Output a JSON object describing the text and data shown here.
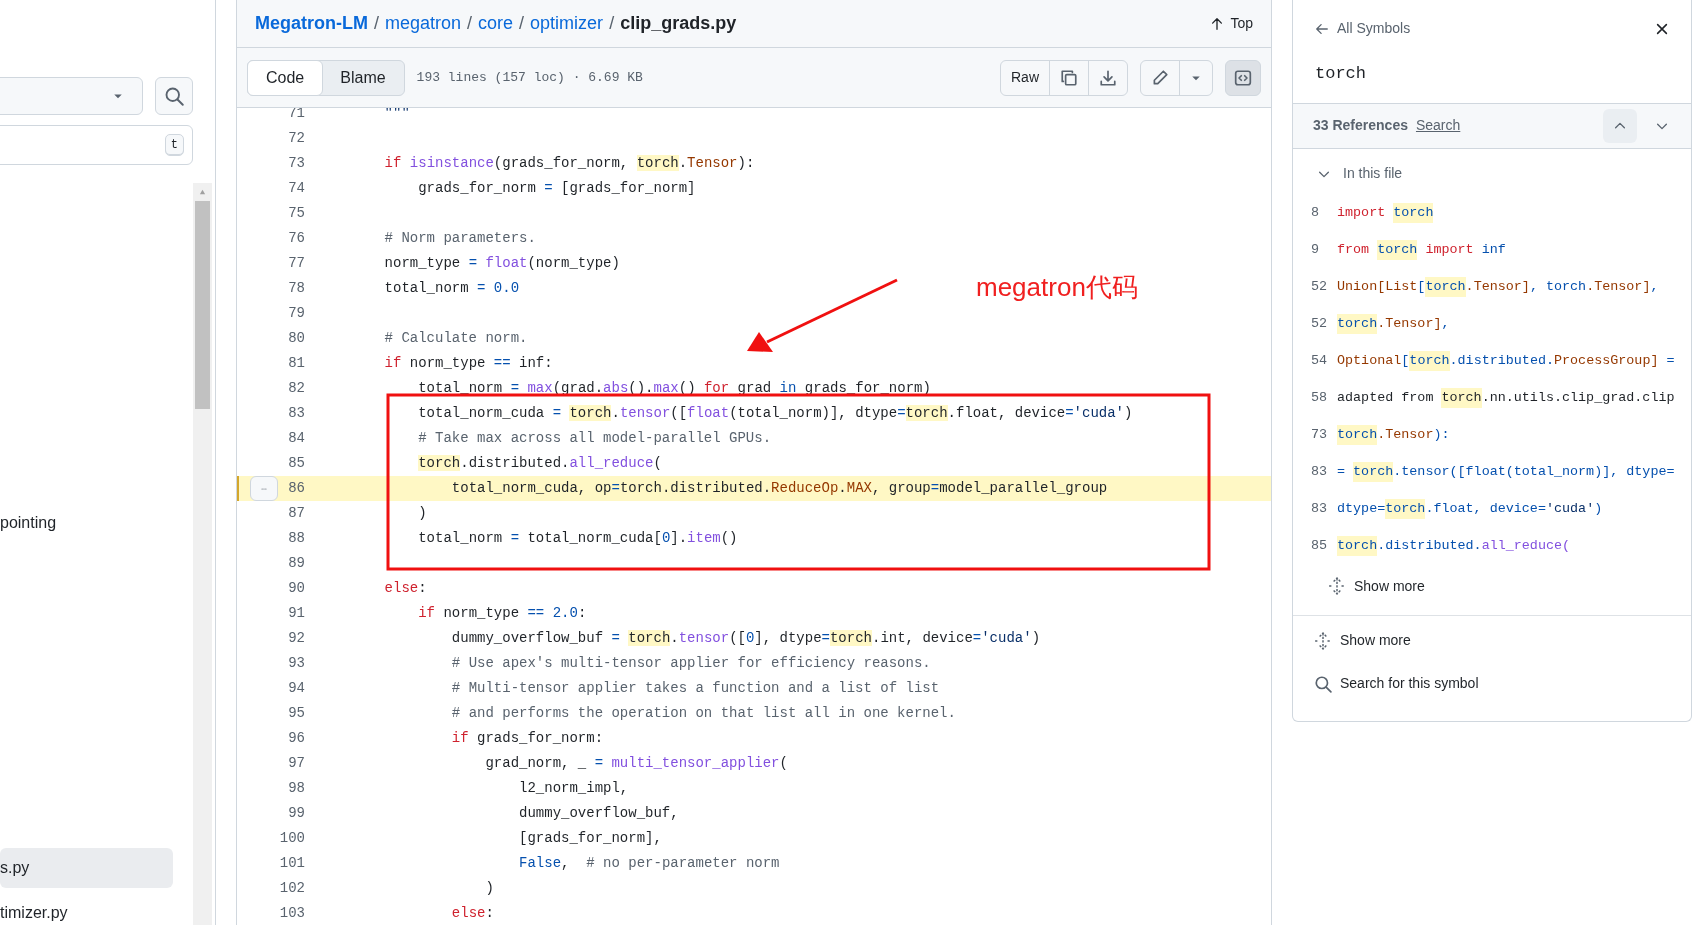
{
  "sidebar": {
    "filter_key": "t",
    "items": [
      {
        "label": "pointing",
        "selected": false
      },
      {
        "label": "s.py",
        "selected": true
      },
      {
        "label": "timizer.py",
        "selected": false
      }
    ]
  },
  "breadcrumb": [
    {
      "label": "Megatron-LM",
      "kind": "repo"
    },
    {
      "label": "/",
      "kind": "separator"
    },
    {
      "label": "megatron",
      "kind": "link"
    },
    {
      "label": "/",
      "kind": "separator"
    },
    {
      "label": "core",
      "kind": "link"
    },
    {
      "label": "/",
      "kind": "separator"
    },
    {
      "label": "optimizer",
      "kind": "link"
    },
    {
      "label": "/",
      "kind": "separator"
    },
    {
      "label": "clip_grads.py",
      "kind": "current"
    }
  ],
  "top_link": "Top",
  "toolbar": {
    "tabs": [
      {
        "label": "Code",
        "selected": true
      },
      {
        "label": "Blame",
        "selected": false
      }
    ],
    "file_info": "193 lines (157 loc) · 6.69 KB",
    "raw_button": "Raw",
    "symbols_button_active": true
  },
  "code": {
    "lines": [
      {
        "number": "71",
        "selected": false,
        "tokens": [
          {
            "kind": "str",
            "text": "    \"\"\""
          }
        ]
      },
      {
        "number": "72",
        "selected": false
      },
      {
        "number": "73",
        "selected": false,
        "tokens": [
          {
            "kind": "kw",
            "text": "    if"
          },
          {
            "kind": "fn",
            "text": " isinstance"
          },
          {
            "kind": "plain",
            "text": "(grads_for_norm, "
          },
          {
            "kind": "match",
            "text": "torch"
          },
          {
            "kind": "plain",
            "text": "."
          },
          {
            "kind": "cls",
            "text": "Tensor"
          },
          {
            "kind": "plain",
            "text": "):"
          }
        ]
      },
      {
        "number": "74",
        "selected": false,
        "tokens": [
          {
            "kind": "plain",
            "text": "        grads_for_norm "
          },
          {
            "kind": "num",
            "text": "="
          },
          {
            "kind": "plain",
            "text": " [grads_for_norm]"
          }
        ]
      },
      {
        "number": "75",
        "selected": false
      },
      {
        "number": "76",
        "selected": false,
        "tokens": [
          {
            "kind": "com",
            "text": "    # Norm parameters."
          }
        ]
      },
      {
        "number": "77",
        "selected": false,
        "tokens": [
          {
            "kind": "plain",
            "text": "    norm_type "
          },
          {
            "kind": "num",
            "text": "="
          },
          {
            "kind": "fn",
            "text": " float"
          },
          {
            "kind": "plain",
            "text": "(norm_type)"
          }
        ]
      },
      {
        "number": "78",
        "selected": false,
        "tokens": [
          {
            "kind": "plain",
            "text": "    total_norm "
          },
          {
            "kind": "num",
            "text": "= 0.0"
          }
        ]
      },
      {
        "number": "79",
        "selected": false
      },
      {
        "number": "80",
        "selected": false,
        "tokens": [
          {
            "kind": "com",
            "text": "    # Calculate norm."
          }
        ]
      },
      {
        "number": "81",
        "selected": false,
        "tokens": [
          {
            "kind": "kw",
            "text": "    if"
          },
          {
            "kind": "plain",
            "text": " norm_type "
          },
          {
            "kind": "num",
            "text": "=="
          },
          {
            "kind": "plain",
            "text": " inf:"
          }
        ]
      },
      {
        "number": "82",
        "selected": false,
        "tokens": [
          {
            "kind": "plain",
            "text": "        total_norm "
          },
          {
            "kind": "num",
            "text": "="
          },
          {
            "kind": "fn",
            "text": " max"
          },
          {
            "kind": "plain",
            "text": "(grad."
          },
          {
            "kind": "fn",
            "text": "abs"
          },
          {
            "kind": "plain",
            "text": "()."
          },
          {
            "kind": "fn",
            "text": "max"
          },
          {
            "kind": "plain",
            "text": "() "
          },
          {
            "kind": "kw",
            "text": "for"
          },
          {
            "kind": "plain",
            "text": " grad "
          },
          {
            "kind": "num",
            "text": "in"
          },
          {
            "kind": "plain",
            "text": " grads_for_norm)"
          }
        ]
      },
      {
        "number": "83",
        "selected": false,
        "tokens": [
          {
            "kind": "plain",
            "text": "        total_norm_cuda "
          },
          {
            "kind": "num",
            "text": "= "
          },
          {
            "kind": "match",
            "text": "torch"
          },
          {
            "kind": "plain",
            "text": "."
          },
          {
            "kind": "fn",
            "text": "tensor"
          },
          {
            "kind": "plain",
            "text": "(["
          },
          {
            "kind": "fn",
            "text": "float"
          },
          {
            "kind": "plain",
            "text": "(total_norm)], dtype"
          },
          {
            "kind": "num",
            "text": "="
          },
          {
            "kind": "match",
            "text": "torch"
          },
          {
            "kind": "plain",
            "text": ".float, device"
          },
          {
            "kind": "num",
            "text": "="
          },
          {
            "kind": "str",
            "text": "'cuda'"
          },
          {
            "kind": "plain",
            "text": ")"
          }
        ]
      },
      {
        "number": "84",
        "selected": false,
        "tokens": [
          {
            "kind": "com",
            "text": "        # Take max across all model-parallel GPUs."
          }
        ]
      },
      {
        "number": "85",
        "selected": false,
        "tokens": [
          {
            "kind": "match",
            "text": "        torch"
          },
          {
            "kind": "plain",
            "text": ".distributed."
          },
          {
            "kind": "fn",
            "text": "all_reduce"
          },
          {
            "kind": "plain",
            "text": "("
          }
        ]
      },
      {
        "number": "86",
        "selected": true,
        "tokens": [
          {
            "kind": "plain",
            "text": "            total_norm_cuda, op"
          },
          {
            "kind": "num",
            "text": "="
          },
          {
            "kind": "match",
            "text": "torch"
          },
          {
            "kind": "plain",
            "text": ".distributed."
          },
          {
            "kind": "cls",
            "text": "ReduceOp"
          },
          {
            "kind": "plain",
            "text": "."
          },
          {
            "kind": "cls",
            "text": "MAX"
          },
          {
            "kind": "plain",
            "text": ", group"
          },
          {
            "kind": "num",
            "text": "="
          },
          {
            "kind": "plain",
            "text": "model_parallel_group"
          }
        ]
      },
      {
        "number": "87",
        "selected": false,
        "tokens": [
          {
            "kind": "plain",
            "text": "        )"
          }
        ]
      },
      {
        "number": "88",
        "selected": false,
        "tokens": [
          {
            "kind": "plain",
            "text": "        total_norm "
          },
          {
            "kind": "num",
            "text": "="
          },
          {
            "kind": "plain",
            "text": " total_norm_cuda["
          },
          {
            "kind": "num",
            "text": "0"
          },
          {
            "kind": "plain",
            "text": "]."
          },
          {
            "kind": "fn",
            "text": "item"
          },
          {
            "kind": "plain",
            "text": "()"
          }
        ]
      },
      {
        "number": "89",
        "selected": false
      },
      {
        "number": "90",
        "selected": false,
        "tokens": [
          {
            "kind": "kw",
            "text": "    else"
          },
          {
            "kind": "plain",
            "text": ":"
          }
        ]
      },
      {
        "number": "91",
        "selected": false,
        "tokens": [
          {
            "kind": "kw",
            "text": "        if"
          },
          {
            "kind": "plain",
            "text": " norm_type "
          },
          {
            "kind": "num",
            "text": "== 2.0"
          },
          {
            "kind": "plain",
            "text": ":"
          }
        ]
      },
      {
        "number": "92",
        "selected": false,
        "tokens": [
          {
            "kind": "plain",
            "text": "            dummy_overflow_buf "
          },
          {
            "kind": "num",
            "text": "= "
          },
          {
            "kind": "match",
            "text": "torch"
          },
          {
            "kind": "plain",
            "text": "."
          },
          {
            "kind": "fn",
            "text": "tensor"
          },
          {
            "kind": "plain",
            "text": "(["
          },
          {
            "kind": "num",
            "text": "0"
          },
          {
            "kind": "plain",
            "text": "], dtype"
          },
          {
            "kind": "num",
            "text": "="
          },
          {
            "kind": "match",
            "text": "torch"
          },
          {
            "kind": "plain",
            "text": ".int, device"
          },
          {
            "kind": "num",
            "text": "="
          },
          {
            "kind": "str",
            "text": "'cuda'"
          },
          {
            "kind": "plain",
            "text": ")"
          }
        ]
      },
      {
        "number": "93",
        "selected": false,
        "tokens": [
          {
            "kind": "com",
            "text": "            # Use apex's multi-tensor applier for efficiency reasons."
          }
        ]
      },
      {
        "number": "94",
        "selected": false,
        "tokens": [
          {
            "kind": "com",
            "text": "            # Multi-tensor applier takes a function and a list of list"
          }
        ]
      },
      {
        "number": "95",
        "selected": false,
        "tokens": [
          {
            "kind": "com",
            "text": "            # and performs the operation on that list all in one kernel."
          }
        ]
      },
      {
        "number": "96",
        "selected": false,
        "tokens": [
          {
            "kind": "kw",
            "text": "            if"
          },
          {
            "kind": "plain",
            "text": " grads_for_norm:"
          }
        ]
      },
      {
        "number": "97",
        "selected": false,
        "tokens": [
          {
            "kind": "plain",
            "text": "                grad_norm, _ "
          },
          {
            "kind": "num",
            "text": "="
          },
          {
            "kind": "fn",
            "text": " multi_tensor_applier"
          },
          {
            "kind": "plain",
            "text": "("
          }
        ]
      },
      {
        "number": "98",
        "selected": false,
        "tokens": [
          {
            "kind": "plain",
            "text": "                    l2_norm_impl,"
          }
        ]
      },
      {
        "number": "99",
        "selected": false,
        "tokens": [
          {
            "kind": "plain",
            "text": "                    dummy_overflow_buf,"
          }
        ]
      },
      {
        "number": "100",
        "selected": false,
        "tokens": [
          {
            "kind": "plain",
            "text": "                    [grads_for_norm],"
          }
        ]
      },
      {
        "number": "101",
        "selected": false,
        "tokens": [
          {
            "kind": "num",
            "text": "                    False"
          },
          {
            "kind": "plain",
            "text": ",  "
          },
          {
            "kind": "com",
            "text": "# no per-parameter norm"
          }
        ]
      },
      {
        "number": "102",
        "selected": false,
        "tokens": [
          {
            "kind": "plain",
            "text": "                )"
          }
        ]
      },
      {
        "number": "103",
        "selected": false,
        "tokens": [
          {
            "kind": "kw",
            "text": "            else"
          },
          {
            "kind": "plain",
            "text": ":"
          }
        ]
      }
    ]
  },
  "annotation": {
    "text": "megatron代码"
  },
  "symbols_panel": {
    "back_label": "All Symbols",
    "symbol": "torch",
    "references_count": "33 References",
    "search_label": "Search",
    "section": {
      "label": "In this file",
      "expanded": true
    },
    "references": [
      {
        "line": "8",
        "tokens": [
          {
            "kind": "kw",
            "text": "import "
          },
          {
            "kind": "matchb",
            "text": "torch"
          }
        ]
      },
      {
        "line": "9",
        "tokens": [
          {
            "kind": "kw",
            "text": "from "
          },
          {
            "kind": "matchb",
            "text": "torch"
          },
          {
            "kind": "kw",
            "text": " import "
          },
          {
            "kind": "num",
            "text": "inf"
          }
        ]
      },
      {
        "line": "52",
        "tokens": [
          {
            "kind": "cls",
            "text": "Union[List"
          },
          {
            "kind": "num",
            "text": "["
          },
          {
            "kind": "matchb",
            "text": "torch"
          },
          {
            "kind": "cls",
            "text": ".Tensor]"
          },
          {
            "kind": "num",
            "text": ", torch"
          },
          {
            "kind": "cls",
            "text": ".Tensor]"
          },
          {
            "kind": "num",
            "text": ","
          }
        ]
      },
      {
        "line": "52",
        "tokens": [
          {
            "kind": "matchb",
            "text": "torch"
          },
          {
            "kind": "cls",
            "text": ".Tensor]"
          },
          {
            "kind": "num",
            "text": ","
          }
        ]
      },
      {
        "line": "54",
        "tokens": [
          {
            "kind": "cls",
            "text": "Optional"
          },
          {
            "kind": "num",
            "text": "["
          },
          {
            "kind": "matchb",
            "text": "torch"
          },
          {
            "kind": "num",
            "text": ".distributed."
          },
          {
            "kind": "cls",
            "text": "ProcessGroup]"
          },
          {
            "kind": "num",
            "text": " ="
          }
        ]
      },
      {
        "line": "58",
        "tokens": [
          {
            "kind": "plain",
            "text": "adapted from "
          },
          {
            "kind": "match",
            "text": "torch"
          },
          {
            "kind": "plain",
            "text": ".nn.utils.clip_grad.clip"
          }
        ]
      },
      {
        "line": "73",
        "tokens": [
          {
            "kind": "matchb",
            "text": "torch"
          },
          {
            "kind": "cls",
            "text": ".Tensor"
          },
          {
            "kind": "num",
            "text": "):"
          }
        ]
      },
      {
        "line": "83",
        "tokens": [
          {
            "kind": "num",
            "text": "= "
          },
          {
            "kind": "matchb",
            "text": "torch"
          },
          {
            "kind": "num",
            "text": ".tensor([float(total_norm)], dtype="
          }
        ]
      },
      {
        "line": "83",
        "tokens": [
          {
            "kind": "num",
            "text": "dtype="
          },
          {
            "kind": "matchb",
            "text": "torch"
          },
          {
            "kind": "num",
            "text": ".float, device="
          },
          {
            "kind": "str",
            "text": "'cuda'"
          },
          {
            "kind": "num",
            "text": ")"
          }
        ]
      },
      {
        "line": "85",
        "tokens": [
          {
            "kind": "matchb",
            "text": "torch"
          },
          {
            "kind": "num",
            "text": ".distributed."
          },
          {
            "kind": "fn",
            "text": "all_reduce("
          }
        ]
      }
    ],
    "section_show_more": "Show more",
    "show_more": "Show more",
    "search_symbol": "Search for this symbol"
  }
}
